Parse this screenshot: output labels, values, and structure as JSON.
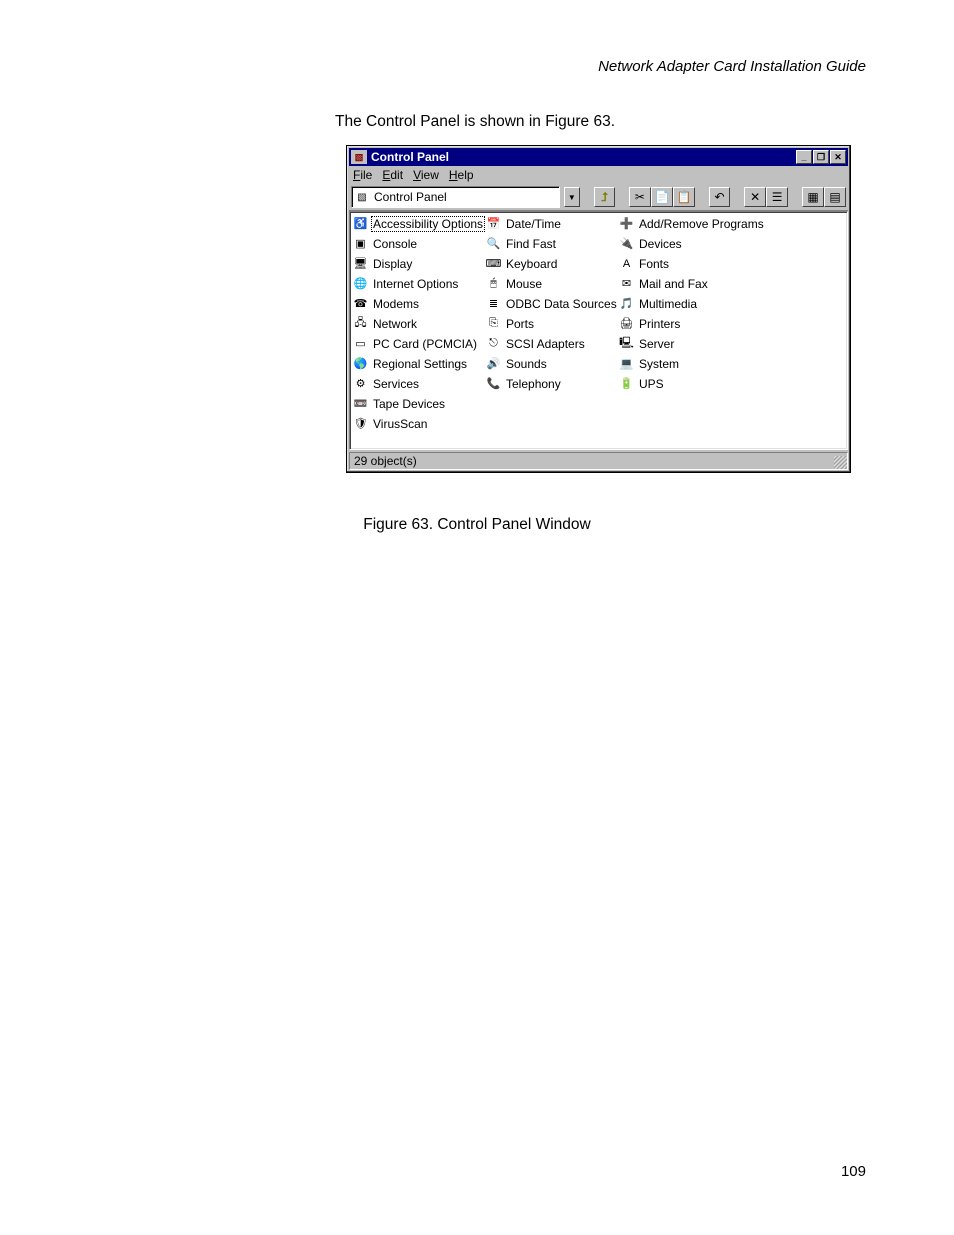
{
  "doc": {
    "header": "Network Adapter Card Installation Guide",
    "intro": "The Control Panel is shown in Figure 63.",
    "caption": "Figure 63. Control Panel Window",
    "page": "109"
  },
  "window": {
    "title": "Control Panel",
    "menu": {
      "file": "File",
      "edit": "Edit",
      "view": "View",
      "help": "Help"
    },
    "address": "Control Panel",
    "status": "29 object(s)"
  },
  "icons": {
    "sys": "▧",
    "min": "_",
    "max": "❐",
    "close": "✕",
    "drop": "▼",
    "up": "⮥",
    "cut": "✂",
    "copy": "📄",
    "paste": "📋",
    "undo": "↶",
    "delete": "✕",
    "props": "☰",
    "large": "▦",
    "small": "▤",
    "access": "♿",
    "addrem": "➕",
    "console": "▣",
    "date": "📅",
    "devices": "🔌",
    "display": "🖥",
    "findfast": "🔍",
    "fonts": "A",
    "internet": "🌐",
    "keyboard": "⌨",
    "mail": "✉",
    "modems": "☎",
    "mouse": "🖱",
    "multimedia": "🎵",
    "network": "🖧",
    "odbc": "≣",
    "pccard": "▭",
    "ports": "⎘",
    "printers": "🖨",
    "regional": "🌎",
    "scsi": "⎋",
    "server": "🖳",
    "services": "⚙",
    "sounds": "🔊",
    "system": "💻",
    "tape": "📼",
    "telephony": "📞",
    "ups": "🔋",
    "virus": "🛡"
  },
  "items": {
    "col1": [
      {
        "k": "access",
        "label": "Accessibility Options",
        "sel": true
      },
      {
        "k": "console",
        "label": "Console"
      },
      {
        "k": "display",
        "label": "Display"
      },
      {
        "k": "internet",
        "label": "Internet Options"
      },
      {
        "k": "modems",
        "label": "Modems"
      },
      {
        "k": "network",
        "label": "Network"
      },
      {
        "k": "pccard",
        "label": "PC Card (PCMCIA)"
      },
      {
        "k": "regional",
        "label": "Regional Settings"
      },
      {
        "k": "services",
        "label": "Services"
      },
      {
        "k": "tape",
        "label": "Tape Devices"
      },
      {
        "k": "virus",
        "label": "VirusScan"
      }
    ],
    "col2": [
      {
        "k": "date",
        "label": "Date/Time"
      },
      {
        "k": "findfast",
        "label": "Find Fast"
      },
      {
        "k": "keyboard",
        "label": "Keyboard"
      },
      {
        "k": "mouse",
        "label": "Mouse"
      },
      {
        "k": "odbc",
        "label": "ODBC Data Sources"
      },
      {
        "k": "ports",
        "label": "Ports"
      },
      {
        "k": "scsi",
        "label": "SCSI Adapters"
      },
      {
        "k": "sounds",
        "label": "Sounds"
      },
      {
        "k": "telephony",
        "label": "Telephony"
      }
    ],
    "col3": [
      {
        "k": "addrem",
        "label": "Add/Remove Programs"
      },
      {
        "k": "devices",
        "label": "Devices"
      },
      {
        "k": "fonts",
        "label": "Fonts"
      },
      {
        "k": "mail",
        "label": "Mail and Fax"
      },
      {
        "k": "multimedia",
        "label": "Multimedia"
      },
      {
        "k": "printers",
        "label": "Printers"
      },
      {
        "k": "server",
        "label": "Server"
      },
      {
        "k": "system",
        "label": "System"
      },
      {
        "k": "ups",
        "label": "UPS"
      }
    ]
  }
}
